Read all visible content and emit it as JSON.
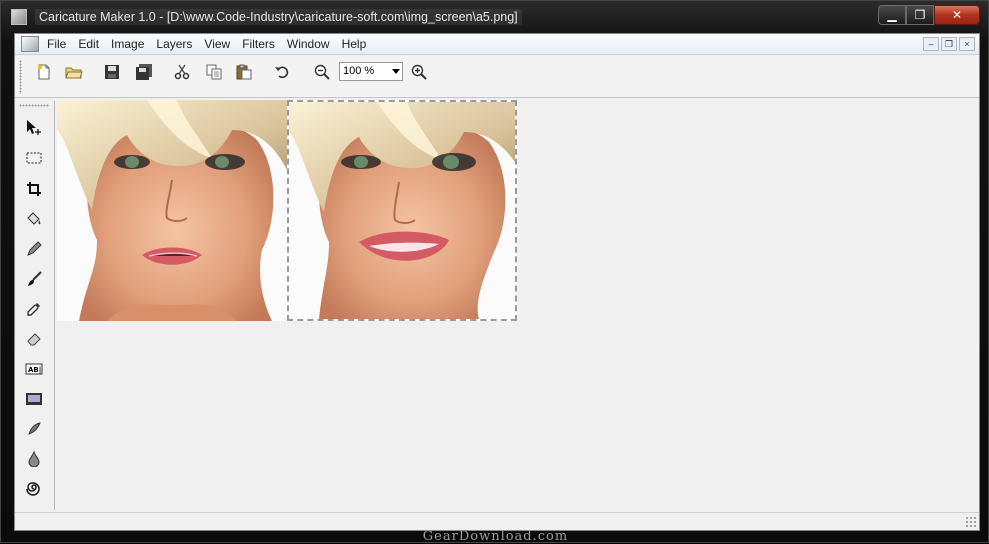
{
  "window": {
    "title": "Caricature Maker 1.0 - [D:\\www.Code-Industry\\caricature-soft.com\\img_screen\\a5.png]",
    "minimize_label": "▁",
    "maximize_label": "❐",
    "close_label": "✕"
  },
  "menu": {
    "items": [
      "File",
      "Edit",
      "Image",
      "Layers",
      "View",
      "Filters",
      "Window",
      "Help"
    ],
    "mdi_minimize": "–",
    "mdi_restore": "❐",
    "mdi_close": "×"
  },
  "toolbar": {
    "new_icon": "new-document-icon",
    "open_icon": "open-folder-icon",
    "save_icon": "save-icon",
    "save_all_icon": "save-all-icon",
    "cut_icon": "scissors-icon",
    "copy_icon": "copy-icon",
    "paste_icon": "paste-icon",
    "undo_icon": "undo-icon",
    "zoom_out_icon": "zoom-out-icon",
    "zoom_value": "100 %",
    "zoom_in_icon": "zoom-in-icon"
  },
  "tools": [
    "move-icon",
    "rect-select-icon",
    "crop-icon",
    "fill-bucket-icon",
    "pencil-icon",
    "brush-icon",
    "eyedropper-icon",
    "eraser-icon",
    "text-icon",
    "image-icon",
    "smudge-icon",
    "drop-icon",
    "swirl-icon"
  ],
  "images": {
    "left_label": "original-photo",
    "right_label": "caricature-photo"
  },
  "watermark": "GearDownload.com"
}
